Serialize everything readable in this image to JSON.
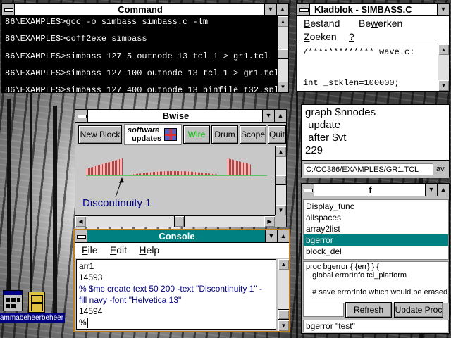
{
  "command": {
    "title": "Command",
    "lines": [
      "86\\EXAMPLES>gcc -o simbass simbass.c -lm",
      "86\\EXAMPLES>coff2exe simbass",
      "86\\EXAMPLES>simbass 127 5 outnode 13 tcl 1 > gr1.tcl",
      "86\\EXAMPLES>simbass 127 100 outnode 13 tcl 1 > gr1.tcl",
      "86\\EXAMPLES>simbass 127 400 outnode 13 binfile t32.spl"
    ]
  },
  "kladblok": {
    "title": "Kladblok - SIMBASS.C",
    "menu": [
      {
        "pre": "",
        "key": "B",
        "post": "estand"
      },
      {
        "pre": "Be",
        "key": "w",
        "post": "erken"
      },
      {
        "pre": "",
        "key": "Z",
        "post": "oeken"
      },
      {
        "pre": "",
        "key": "?",
        "post": ""
      }
    ],
    "lines": [
      "/************* wave.c:",
      "",
      "",
      "int _stklen=100000;"
    ]
  },
  "graph": {
    "lines": [
      "graph $nnodes",
      " update",
      " after $vt",
      "229"
    ],
    "path": "C:/CC386/EXAMPLES/GR1.TCL",
    "path_suffix": "av"
  },
  "bwise": {
    "title": "Bwise",
    "buttons": [
      "New Block",
      "Wire",
      "Drum",
      "Scope",
      "Quit"
    ],
    "logo_line1": "software",
    "logo_line2": "updates",
    "label": "Discontinuity 1",
    "wire_color": "#00c000",
    "bar_color": "#e03030",
    "label_color": "#000080"
  },
  "console": {
    "title": "Console",
    "menu": [
      {
        "key": "F",
        "post": "ile"
      },
      {
        "key": "E",
        "post": "dit"
      },
      {
        "key": "H",
        "post": "elp"
      }
    ],
    "lines": [
      {
        "text": "arr1",
        "color": "#000000"
      },
      {
        "text": "14593",
        "color": "#000000"
      },
      {
        "text": "% $mc create text 50 200 -text \"Discontinuity 1\" -",
        "color": "#000080"
      },
      {
        "text": "fill navy -font \"Helvetica 13\"",
        "color": "#000080"
      },
      {
        "text": "14594",
        "color": "#000000"
      },
      {
        "text": "%",
        "color": "#000000"
      }
    ]
  },
  "procs": {
    "title": "f",
    "items": [
      "Display_func",
      "allspaces",
      "array2list",
      "bgerror",
      "block_del"
    ],
    "selected_index": 3,
    "code_lines": [
      "proc bgerror { {err} } {",
      "   global errorInfo tcl_platform",
      "",
      "   # save errorInfo which would be erased"
    ],
    "refresh_label": "Refresh List",
    "update_label": "Update Proc",
    "bottom_text": "bgerror \"test\""
  },
  "desktop": {
    "icon_label": "ammabeheerbeheer"
  }
}
